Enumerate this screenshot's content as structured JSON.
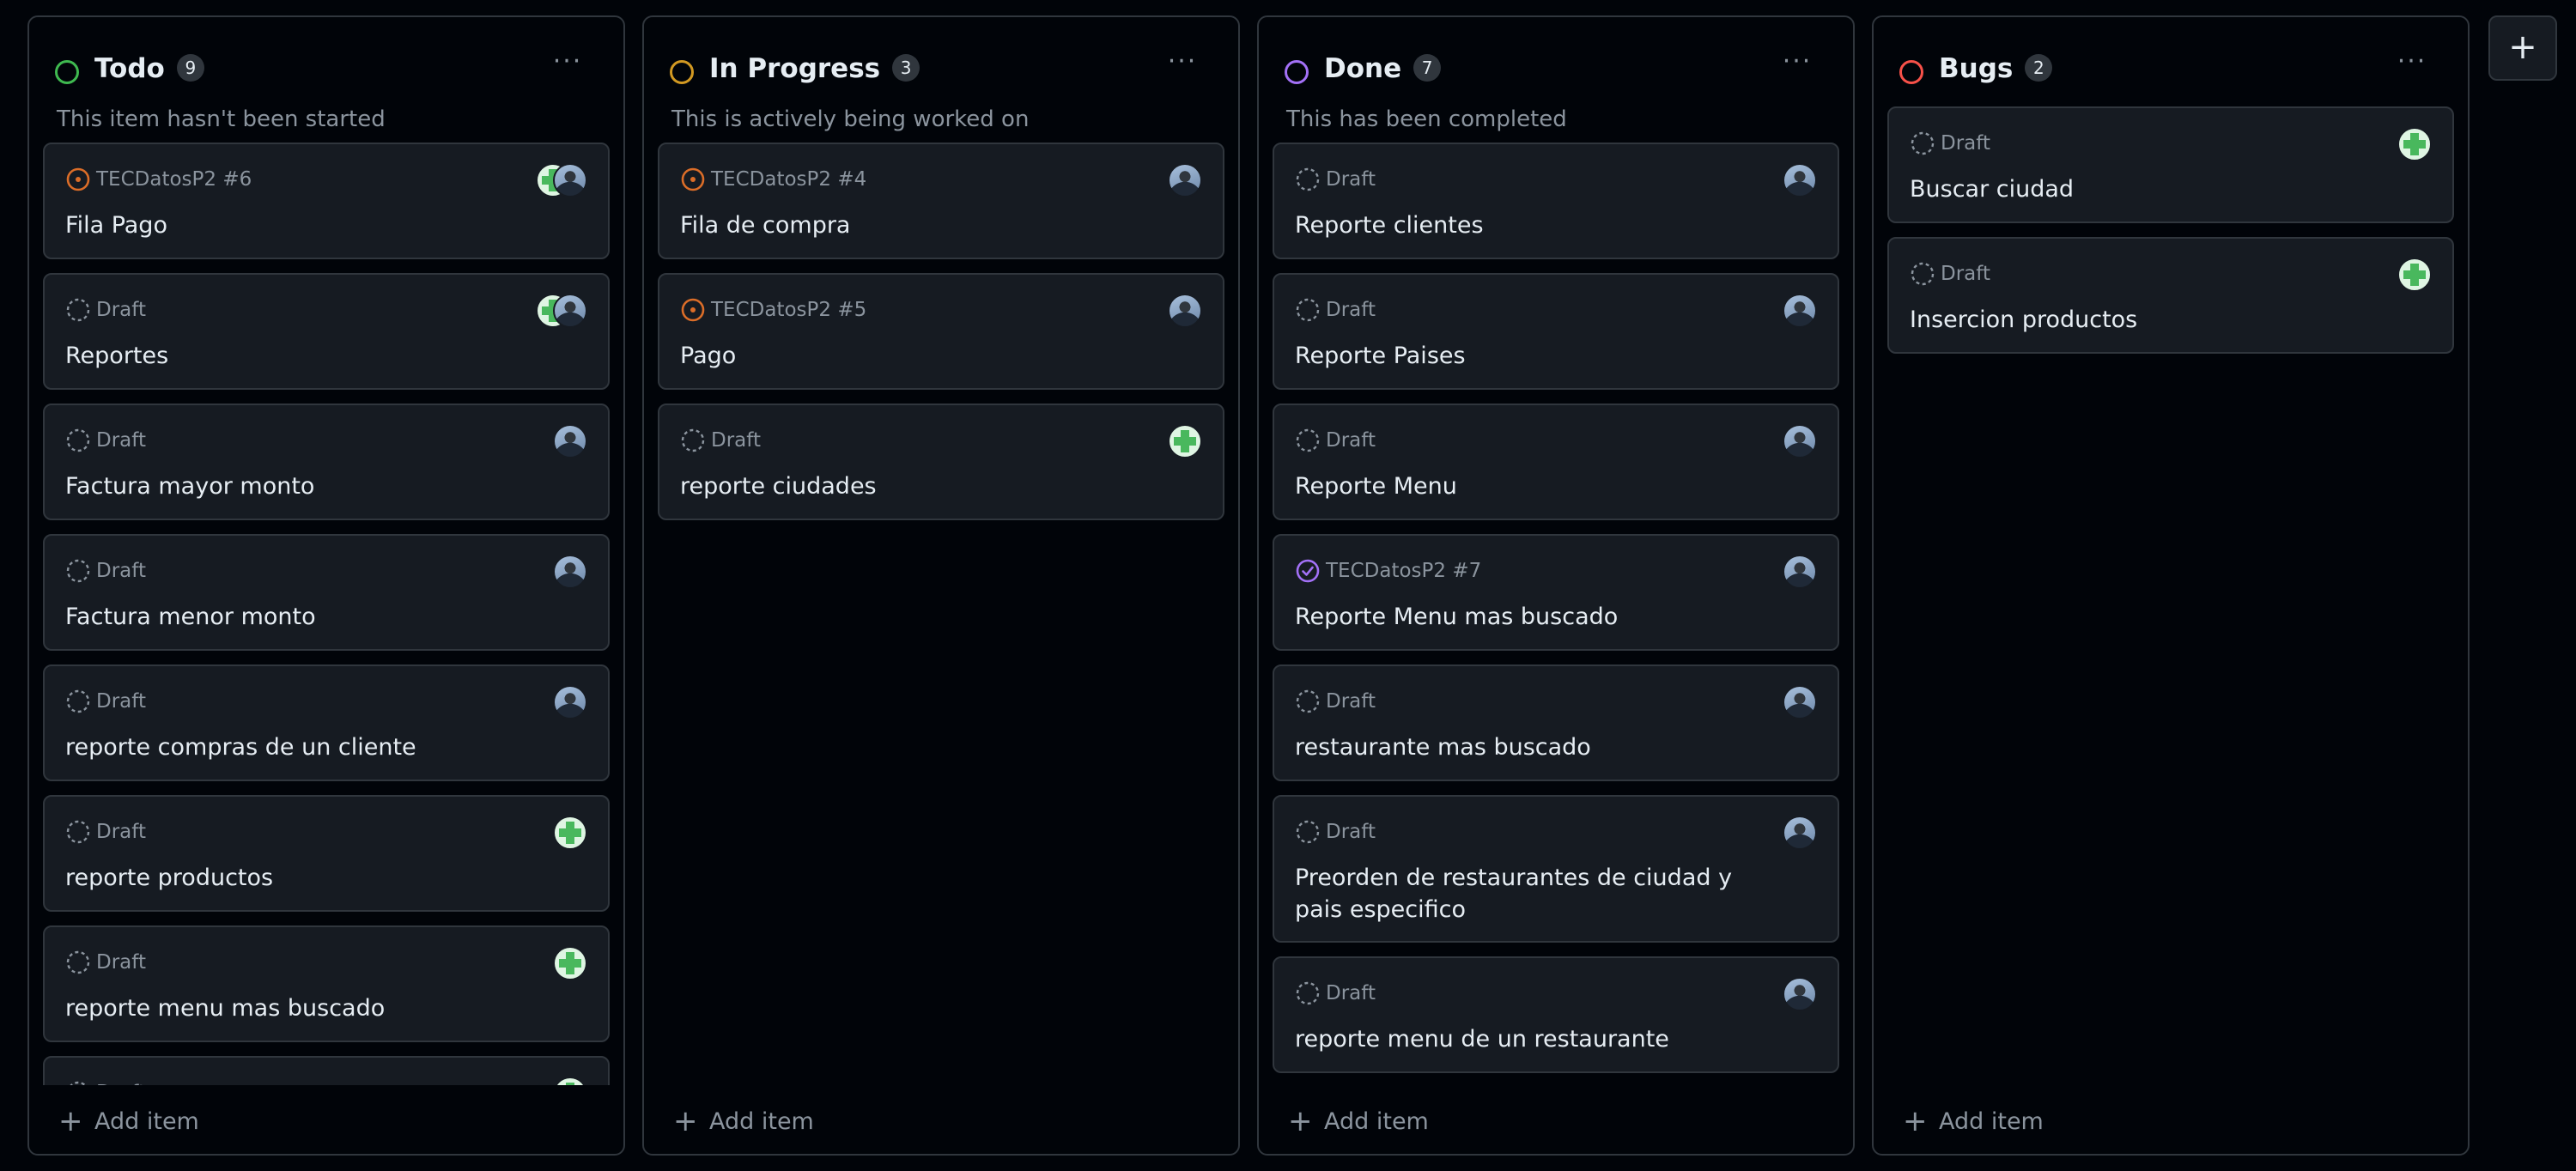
{
  "add_column_label": "+",
  "columns": [
    {
      "title": "Todo",
      "count": "9",
      "description": "This item hasn't been started",
      "accent": "#3fb950",
      "menu": "···",
      "add_label": "Add item",
      "cards": [
        {
          "meta": "TECDatosP2 #6",
          "title": "Fila Pago",
          "status": "open-issue-icon",
          "avatars": [
            "avatar-plus",
            "avatar-photo"
          ]
        },
        {
          "meta": "Draft",
          "title": "Reportes",
          "status": "draft-icon",
          "avatars": [
            "avatar-plus",
            "avatar-photo"
          ]
        },
        {
          "meta": "Draft",
          "title": "Factura mayor monto",
          "status": "draft-icon",
          "avatars": [
            "avatar-photo"
          ]
        },
        {
          "meta": "Draft",
          "title": "Factura menor monto",
          "status": "draft-icon",
          "avatars": [
            "avatar-photo"
          ]
        },
        {
          "meta": "Draft",
          "title": "reporte compras de un cliente",
          "status": "draft-icon",
          "avatars": [
            "avatar-photo"
          ]
        },
        {
          "meta": "Draft",
          "title": "reporte productos",
          "status": "draft-icon",
          "avatars": [
            "avatar-plus"
          ]
        },
        {
          "meta": "Draft",
          "title": "reporte menu mas buscado",
          "status": "draft-icon",
          "avatars": [
            "avatar-plus"
          ]
        },
        {
          "meta": "Draft",
          "title": "",
          "status": "draft-icon",
          "avatars": [
            "avatar-plus"
          ]
        }
      ]
    },
    {
      "title": "In Progress",
      "count": "3",
      "description": "This is actively being worked on",
      "accent": "#d29922",
      "menu": "···",
      "add_label": "Add item",
      "cards": [
        {
          "meta": "TECDatosP2 #4",
          "title": "Fila de compra",
          "status": "open-issue-icon",
          "avatars": [
            "avatar-photo"
          ]
        },
        {
          "meta": "TECDatosP2 #5",
          "title": "Pago",
          "status": "open-issue-icon",
          "avatars": [
            "avatar-photo"
          ]
        },
        {
          "meta": "Draft",
          "title": "reporte ciudades",
          "status": "draft-icon",
          "avatars": [
            "avatar-plus"
          ]
        }
      ]
    },
    {
      "title": "Done",
      "count": "7",
      "description": "This has been completed",
      "accent": "#a371f7",
      "menu": "···",
      "add_label": "Add item",
      "cards": [
        {
          "meta": "Draft",
          "title": "Reporte clientes",
          "status": "draft-icon",
          "avatars": [
            "avatar-photo"
          ]
        },
        {
          "meta": "Draft",
          "title": "Reporte Paises",
          "status": "draft-icon",
          "avatars": [
            "avatar-photo"
          ]
        },
        {
          "meta": "Draft",
          "title": "Reporte Menu",
          "status": "draft-icon",
          "avatars": [
            "avatar-photo"
          ]
        },
        {
          "meta": "TECDatosP2 #7",
          "title": "Reporte Menu mas buscado",
          "status": "closed-issue-icon",
          "avatars": [
            "avatar-photo"
          ]
        },
        {
          "meta": "Draft",
          "title": "restaurante mas buscado",
          "status": "draft-icon",
          "avatars": [
            "avatar-photo"
          ]
        },
        {
          "meta": "Draft",
          "title": "Preorden de restaurantes de ciudad y pais especifico",
          "status": "draft-icon",
          "avatars": [
            "avatar-photo"
          ]
        },
        {
          "meta": "Draft",
          "title": "reporte menu de un restaurante",
          "status": "draft-icon",
          "avatars": [
            "avatar-photo"
          ]
        }
      ]
    },
    {
      "title": "Bugs",
      "count": "2",
      "description": "",
      "accent": "#f85149",
      "menu": "···",
      "add_label": "Add item",
      "cards": [
        {
          "meta": "Draft",
          "title": "Buscar ciudad",
          "status": "draft-icon",
          "avatars": [
            "avatar-plus"
          ]
        },
        {
          "meta": "Draft",
          "title": "Insercion productos",
          "status": "draft-icon",
          "avatars": [
            "avatar-plus"
          ]
        }
      ]
    }
  ]
}
